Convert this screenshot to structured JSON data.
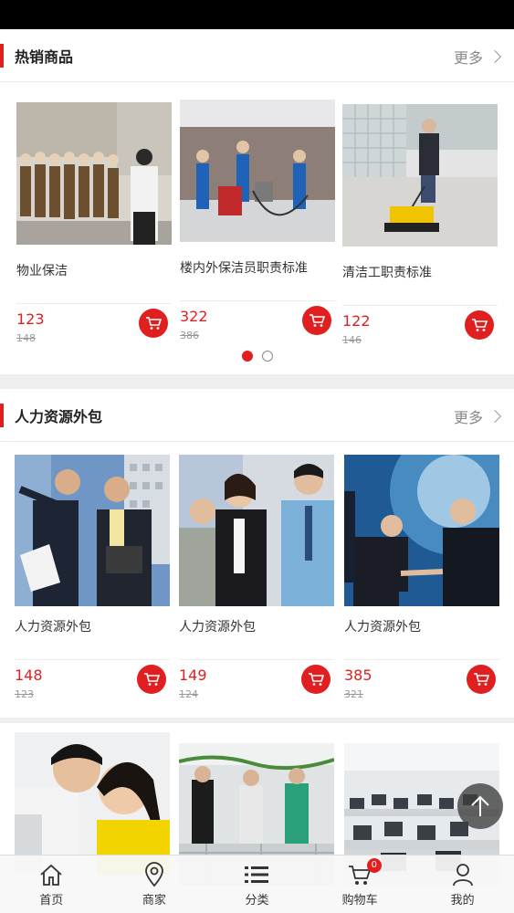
{
  "sections": [
    {
      "title": "热销商品",
      "more": "更多",
      "products": [
        {
          "name": "物业保洁",
          "price": "123",
          "original_price": "148"
        },
        {
          "name": "楼内外保洁员职责标准",
          "price": "322",
          "original_price": "386"
        },
        {
          "name": "清洁工职责标准",
          "price": "122",
          "original_price": "146"
        }
      ]
    },
    {
      "title": "人力资源外包",
      "more": "更多",
      "products": [
        {
          "name": "人力资源外包",
          "price": "148",
          "original_price": "123"
        },
        {
          "name": "人力资源外包",
          "price": "149",
          "original_price": "124"
        },
        {
          "name": "人力资源外包",
          "price": "385",
          "original_price": "321"
        }
      ]
    }
  ],
  "carousel": {
    "count": 2,
    "active": 1
  },
  "bottom_nav": [
    {
      "label": "首页",
      "icon": "home-icon"
    },
    {
      "label": "商家",
      "icon": "location-pin-icon"
    },
    {
      "label": "分类",
      "icon": "list-icon"
    },
    {
      "label": "购物车",
      "icon": "cart-icon",
      "badge": "0"
    },
    {
      "label": "我的",
      "icon": "user-icon"
    }
  ],
  "colors": {
    "accent": "#e02020",
    "background": "#efefef"
  }
}
